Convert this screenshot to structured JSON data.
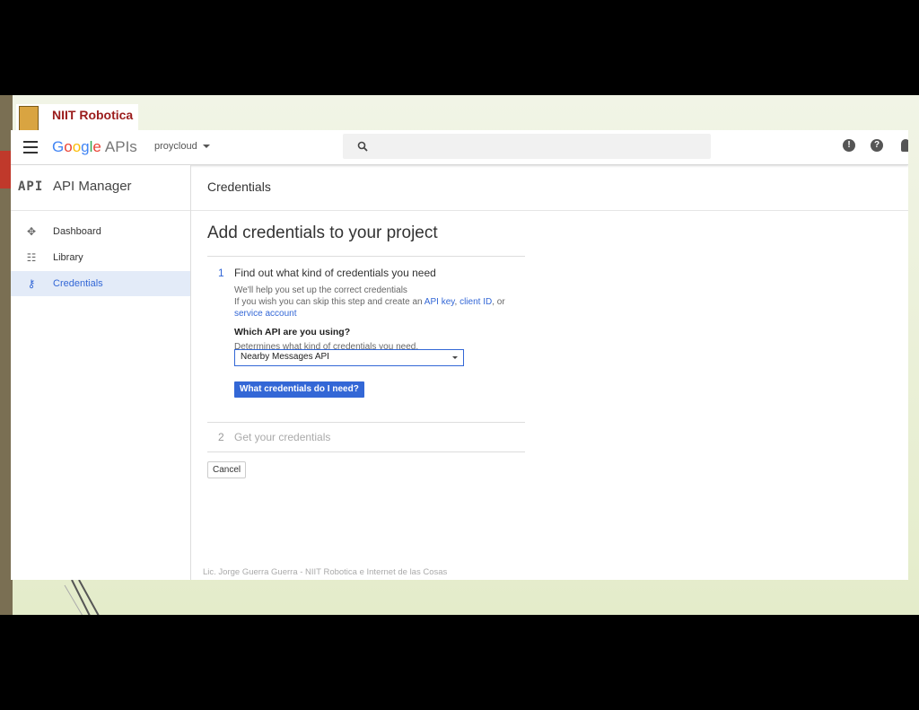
{
  "slide": {
    "logo_text": "NIIT Robotica",
    "footer": "Lic. Jorge Guerra Guerra - NIIT Robotica e Internet de las Cosas"
  },
  "topbar": {
    "brand": "Google",
    "brand_suffix": "APIs",
    "project": "proycloud",
    "icons": [
      "menu-icon",
      "search-icon",
      "feedback-icon",
      "help-icon",
      "notifications-icon"
    ]
  },
  "sidebar": {
    "logo": "API",
    "title": "API Manager",
    "items": [
      {
        "label": "Dashboard",
        "icon": "dashboard-icon",
        "active": false
      },
      {
        "label": "Library",
        "icon": "library-icon",
        "active": false
      },
      {
        "label": "Credentials",
        "icon": "key-icon",
        "active": true
      }
    ]
  },
  "header": {
    "title": "Credentials"
  },
  "main": {
    "title": "Add credentials to your project",
    "step1": {
      "number": "1",
      "title": "Find out what kind of credentials you need",
      "line1": "We'll help you set up the correct credentials",
      "line2_prefix": "If you wish you can skip this step and create an",
      "link_api_key": "API key",
      "link_client_id": "client ID",
      "line2_or": ", or",
      "link_service_account": "service account",
      "question": "Which API are you using?",
      "question_help": "Determines what kind of credentials you need.",
      "select_value": "Nearby Messages API",
      "button": "What credentials do I need?"
    },
    "step2": {
      "number": "2",
      "title": "Get your credentials"
    },
    "cancel": "Cancel"
  },
  "colors": {
    "accent": "#3367d6",
    "active_bg": "#e3ebf8"
  }
}
